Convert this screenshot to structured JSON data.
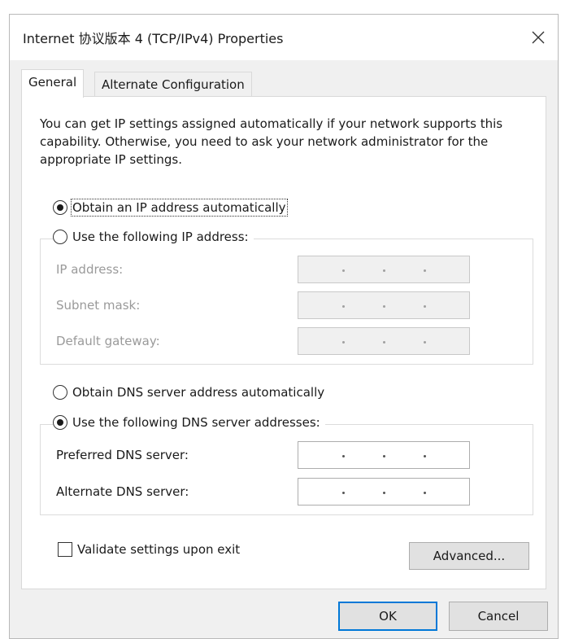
{
  "window": {
    "title": "Internet 协议版本 4 (TCP/IPv4) Properties"
  },
  "tabs": [
    {
      "label": "General",
      "active": true
    },
    {
      "label": "Alternate Configuration",
      "active": false
    }
  ],
  "description": "You can get IP settings assigned automatically if your network supports this capability. Otherwise, you need to ask your network administrator for the appropriate IP settings.",
  "ip_section": {
    "auto_label": "Obtain an IP address automatically",
    "auto_selected": true,
    "manual_label": "Use the following IP address:",
    "manual_selected": false,
    "fields": [
      {
        "label": "IP address:",
        "value": ". . .",
        "enabled": false
      },
      {
        "label": "Subnet mask:",
        "value": ". . .",
        "enabled": false
      },
      {
        "label": "Default gateway:",
        "value": ". . .",
        "enabled": false
      }
    ]
  },
  "dns_section": {
    "auto_label": "Obtain DNS server address automatically",
    "auto_selected": false,
    "manual_label": "Use the following DNS server addresses:",
    "manual_selected": true,
    "fields": [
      {
        "label": "Preferred DNS server:",
        "value": ". . .",
        "enabled": true
      },
      {
        "label": "Alternate DNS server:",
        "value": ". . .",
        "enabled": true
      }
    ]
  },
  "validate": {
    "label": "Validate settings upon exit",
    "checked": false
  },
  "buttons": {
    "advanced": "Advanced...",
    "ok": "OK",
    "cancel": "Cancel"
  },
  "icons": {
    "close": "close-icon"
  },
  "colors": {
    "accent": "#0078d7",
    "dialog_bg": "#f0f0f0",
    "panel_bg": "#ffffff",
    "disabled_text": "#9a9a9a"
  }
}
